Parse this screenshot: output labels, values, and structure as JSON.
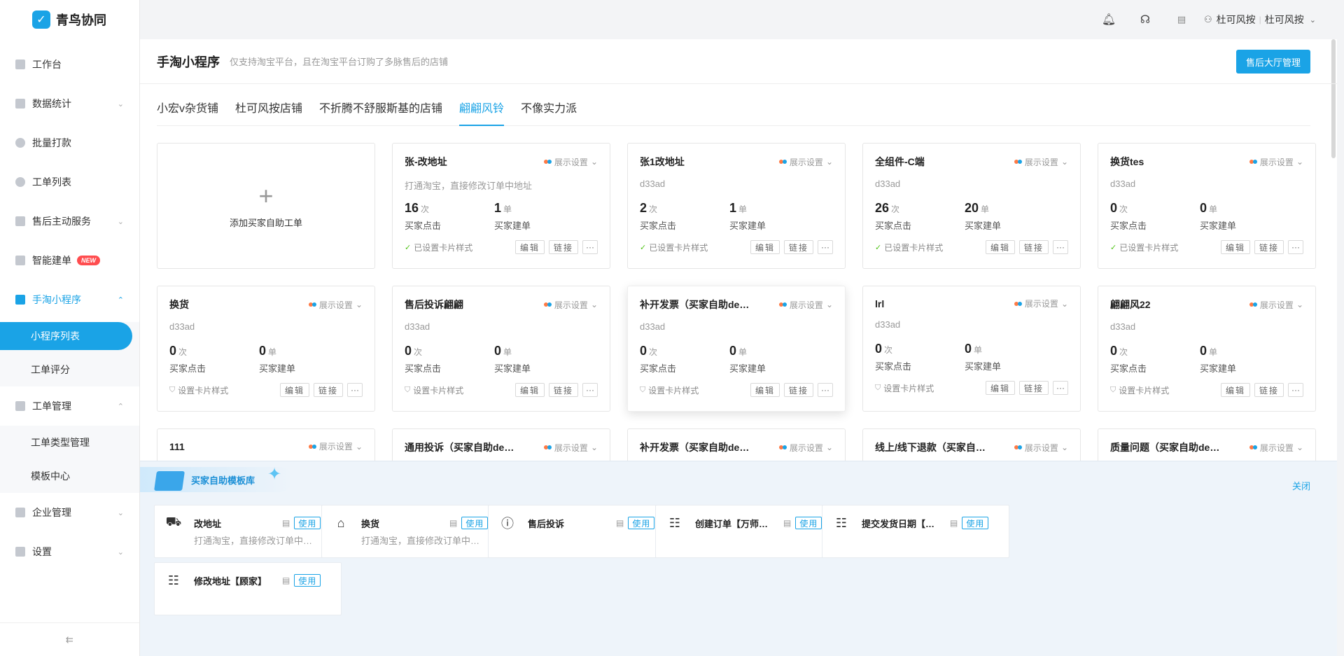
{
  "app": {
    "name": "青鸟协同",
    "logo_glyph": "✓"
  },
  "sidebar": {
    "items": [
      {
        "label": "工作台"
      },
      {
        "label": "数据统计",
        "chev": "⌄"
      },
      {
        "label": "批量打款"
      },
      {
        "label": "工单列表"
      },
      {
        "label": "售后主动服务",
        "chev": "⌄"
      },
      {
        "label": "智能建单",
        "badge": "NEW"
      },
      {
        "label": "手淘小程序",
        "chev": "⌃"
      },
      {
        "label": "工单管理",
        "chev": "⌃"
      },
      {
        "label": "企业管理",
        "chev": "⌄"
      },
      {
        "label": "设置",
        "chev": "⌄"
      }
    ],
    "sub_miniapp": [
      "小程序列表",
      "工单评分"
    ],
    "sub_ticket": [
      "工单类型管理",
      "模板中心"
    ],
    "collapse_glyph": "⇇"
  },
  "topbar": {
    "user": "杜可风按",
    "shop": "杜可风按",
    "sep": "|",
    "chev": "⌄"
  },
  "page": {
    "title": "手淘小程序",
    "subtitle": "仅支持淘宝平台，且在淘宝平台订购了多脉售后的店铺",
    "primary_button": "售后大厅管理",
    "tabs": [
      "小宏v杂货铺",
      "杜可风按店铺",
      "不折腾不舒服斯基的店铺",
      "翩翩风铃",
      "不像实力派"
    ],
    "active_tab": 3
  },
  "add_card": {
    "plus": "+",
    "label": "添加买家自助工单"
  },
  "card_common": {
    "display": "展示设置",
    "click_unit": "次",
    "order_unit": "单",
    "click_label": "买家点击",
    "order_label": "买家建单",
    "edit": "编辑",
    "link": "链接",
    "more": "···",
    "style_set": "已设置卡片样式",
    "style_unset": "设置卡片样式",
    "chev": "⌄"
  },
  "cards": [
    {
      "title": "张-改地址",
      "desc": "打通淘宝，直接修改订单中地址",
      "clicks": "16",
      "orders": "1",
      "style_set": true
    },
    {
      "title": "张1改地址",
      "desc": "d33ad",
      "clicks": "2",
      "orders": "1",
      "style_set": true
    },
    {
      "title": "全组件-C端",
      "desc": "d33ad",
      "clicks": "26",
      "orders": "20",
      "style_set": true
    },
    {
      "title": "换货tes",
      "desc": "d33ad",
      "clicks": "0",
      "orders": "0",
      "style_set": true
    },
    {
      "title": "换货",
      "desc": "d33ad",
      "clicks": "0",
      "orders": "0",
      "style_set": false
    },
    {
      "title": "售后投诉翩翩",
      "desc": "d33ad",
      "clicks": "0",
      "orders": "0",
      "style_set": false
    },
    {
      "title": "补开发票（买家自助de…",
      "desc": "d33ad",
      "clicks": "0",
      "orders": "0",
      "style_set": false
    },
    {
      "title": "lrl",
      "desc": "d33ad",
      "clicks": "0",
      "orders": "0",
      "style_set": false
    },
    {
      "title": "翩翩风22",
      "desc": "d33ad",
      "clicks": "0",
      "orders": "0",
      "style_set": false
    },
    {
      "title": "111"
    },
    {
      "title": "通用投诉（买家自助de…"
    },
    {
      "title": "补开发票（买家自助de…"
    },
    {
      "title": "线上/线下退款（买家自助…"
    },
    {
      "title": "质量问题（买家自助de…"
    }
  ],
  "library": {
    "title": "买家自助模板库",
    "close": "关闭",
    "use": "使用",
    "doc_glyph": "▤",
    "templates": [
      {
        "name": "改地址",
        "desc": "打通淘宝，直接修改订单中…",
        "icon": "truck-icon",
        "glyph": "⛟"
      },
      {
        "name": "换货",
        "desc": "打通淘宝，直接修改订单中…",
        "icon": "home-icon",
        "glyph": "⌂"
      },
      {
        "name": "售后投诉",
        "desc": "",
        "icon": "info-icon",
        "glyph": "ⓘ"
      },
      {
        "name": "创建订单【万师…",
        "desc": "",
        "icon": "checklist-icon",
        "glyph": "☷"
      },
      {
        "name": "提交发货日期【…",
        "desc": "",
        "icon": "checklist-icon",
        "glyph": "☷"
      },
      {
        "name": "修改地址【顾家】",
        "desc": "",
        "icon": "checklist-icon",
        "glyph": "☷"
      }
    ]
  },
  "icons": {
    "bell": "🔔︎",
    "headset": "☊",
    "doc": "▤",
    "user": "⚇"
  },
  "colors": {
    "accent": "#1aa3e6",
    "badge": "#ff4d4f",
    "success": "#52c41a"
  }
}
